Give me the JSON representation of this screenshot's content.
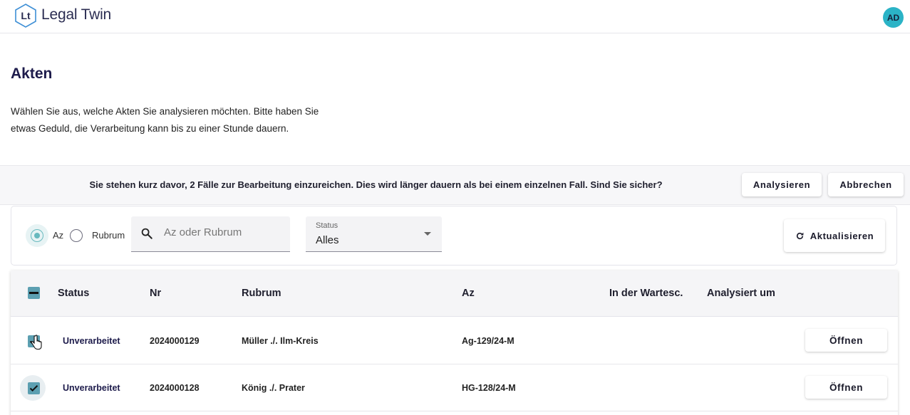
{
  "app": {
    "name": "Legal Twin",
    "logo_text": "Lt",
    "avatar_initials": "AD"
  },
  "page": {
    "title": "Akten",
    "intro_line1": "Wählen Sie aus, welche Akten Sie analysieren möchten. Bitte haben Sie",
    "intro_line2": "etwas Geduld, die Verarbeitung kann bis zu einer Stunde dauern."
  },
  "confirm": {
    "message": "Sie stehen kurz davor, 2 Fälle zur Bearbeitung einzureichen. Dies wird länger dauern als bei einem einzelnen Fall. Sind Sie sicher?",
    "analyze_label": "Analysieren",
    "cancel_label": "Abbrechen"
  },
  "filters": {
    "radio_az_label": "Az",
    "radio_rubrum_label": "Rubrum",
    "selected": "Az",
    "search_placeholder": "Az oder Rubrum",
    "search_value": "",
    "status_label": "Status",
    "status_value": "Alles",
    "refresh_label": "Aktualisieren"
  },
  "table": {
    "columns": [
      "Status",
      "Nr",
      "Rubrum",
      "Az",
      "In der Wartesc.",
      "Analysiert um"
    ],
    "rows": [
      {
        "status": "Unverarbeitet",
        "nr": "2024000129",
        "rubrum": "Müller ./. Ilm-Kreis",
        "az": "Ag-129/24-M",
        "queue": "",
        "analyzed": "",
        "action": "Öffnen",
        "checked": true
      },
      {
        "status": "Unverarbeitet",
        "nr": "2024000128",
        "rubrum": "König ./. Prater",
        "az": "HG-128/24-M",
        "queue": "",
        "analyzed": "",
        "action": "Öffnen",
        "checked": true
      }
    ]
  },
  "colors": {
    "accent": "#68b9be",
    "checkbox": "#5c9fb1",
    "avatar": "#2bb3c6",
    "title": "#1d1b4b"
  }
}
